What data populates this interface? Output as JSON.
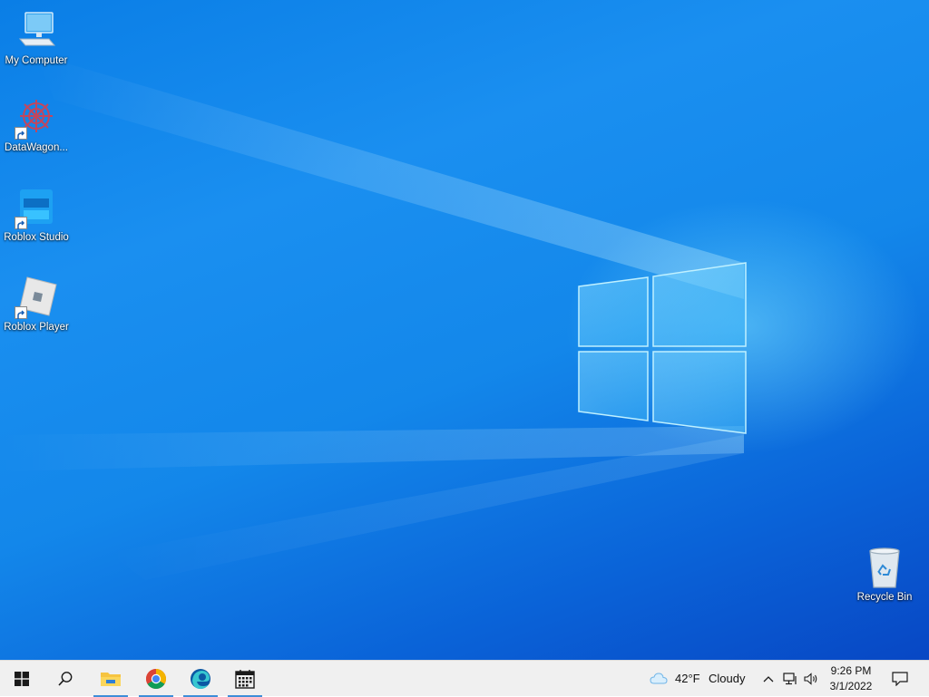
{
  "desktop": {
    "icons": [
      {
        "label": "My Computer",
        "icon": "my-computer-icon"
      },
      {
        "label": "DataWagon...",
        "icon": "datawagon-icon"
      },
      {
        "label": "Roblox Studio",
        "icon": "roblox-studio-icon"
      },
      {
        "label": "Roblox Player",
        "icon": "roblox-player-icon"
      },
      {
        "label": "Recycle Bin",
        "icon": "recycle-bin-icon"
      }
    ]
  },
  "taskbar": {
    "buttons": [
      {
        "name": "start-button",
        "icon": "windows-logo-icon"
      },
      {
        "name": "search-button",
        "icon": "search-icon"
      },
      {
        "name": "file-explorer-button",
        "icon": "folder-icon"
      },
      {
        "name": "chrome-button",
        "icon": "chrome-icon"
      },
      {
        "name": "edge-button",
        "icon": "edge-icon"
      },
      {
        "name": "calendar-app-button",
        "icon": "calendar-icon"
      }
    ],
    "weather": {
      "temp": "42°F",
      "condition": "Cloudy"
    },
    "clock": {
      "time": "9:26 PM",
      "date": "3/1/2022"
    },
    "colors": {
      "taskbar_bg": "#f0f0f0",
      "accent": "#3e8ed8",
      "desktop": "#1387ea"
    }
  }
}
